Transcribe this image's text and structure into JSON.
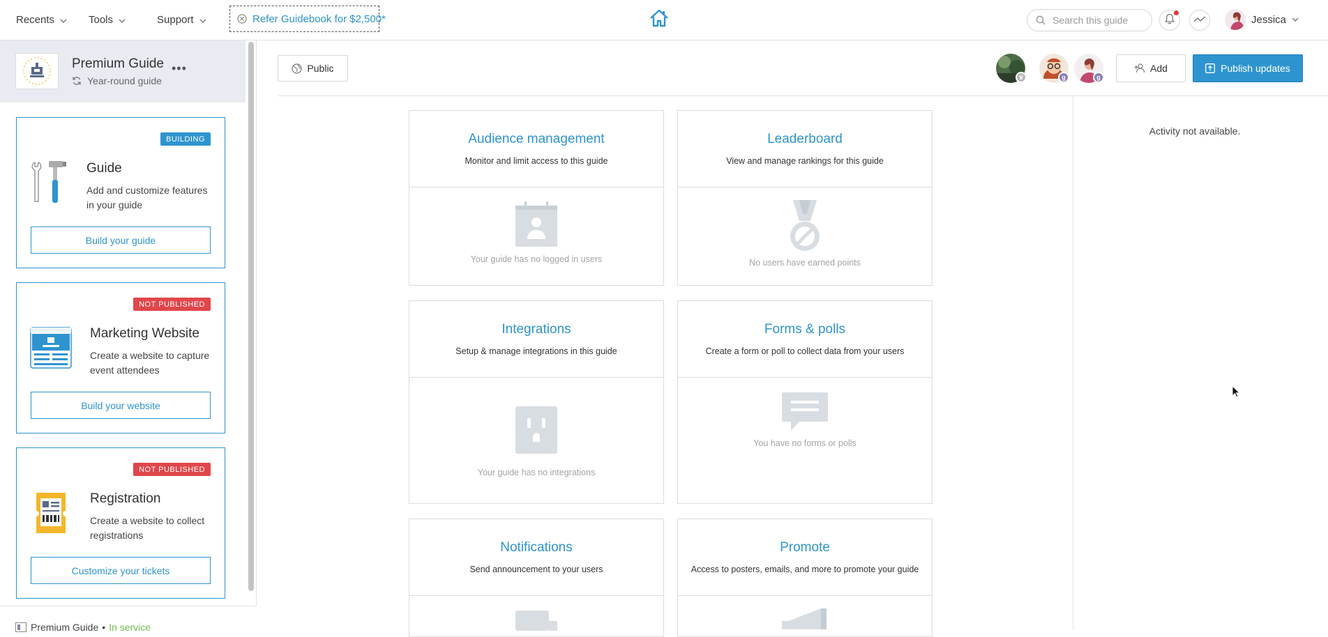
{
  "topbar": {
    "nav": [
      {
        "label": "Recents"
      },
      {
        "label": "Tools"
      },
      {
        "label": "Support"
      }
    ],
    "refer_label": "Refer Guidebook for $2,500*",
    "search_placeholder": "Search this guide",
    "user_name": "Jessica",
    "icons": {
      "home": "home-icon",
      "notifications": "bell-icon",
      "activity": "activity-graph-icon"
    },
    "colors": {
      "accent": "#2e94cf",
      "notification_dot": "#e0383e"
    }
  },
  "sidebar": {
    "guide_name": "Premium Guide",
    "guide_type": "Year-round guide",
    "cards": [
      {
        "badge": "BUILDING",
        "badge_color": "#2e94cf",
        "title": "Guide",
        "description": "Add and customize features in your guide",
        "button": "Build your guide",
        "icon": "tools-icon"
      },
      {
        "badge": "NOT PUBLISHED",
        "badge_color": "#e0464a",
        "title": "Marketing Website",
        "description": "Create a website to capture event attendees",
        "button": "Build your website",
        "icon": "website-icon"
      },
      {
        "badge": "NOT PUBLISHED",
        "badge_color": "#e0464a",
        "title": "Registration",
        "description": "Create a website to collect registrations",
        "button": "Customize your tickets",
        "icon": "ticket-icon"
      }
    ],
    "footer": {
      "guide_name": "Premium Guide",
      "separator": "•",
      "status": "In service",
      "status_color": "#6cc04a"
    }
  },
  "main": {
    "visibility_label": "Public",
    "add_label": "Add",
    "publish_label": "Publish updates",
    "activity_text": "Activity not available.",
    "features": [
      {
        "title": "Audience management",
        "description": "Monitor and limit access to this guide",
        "empty": "Your guide has no logged in users",
        "icon": "badge-id-icon"
      },
      {
        "title": "Leaderboard",
        "description": "View and manage rankings for this guide",
        "empty": "No users have earned points",
        "icon": "medal-icon"
      },
      {
        "title": "Integrations",
        "description": "Setup & manage integrations in this guide",
        "empty": "Your guide has no integrations",
        "icon": "outlet-icon"
      },
      {
        "title": "Forms & polls",
        "description": "Create a form or poll to collect data from your users",
        "empty": "You have no forms or polls",
        "icon": "chat-bubble-icon"
      },
      {
        "title": "Notifications",
        "description": "Send announcement to your users",
        "empty": "",
        "icon": "notification-icon"
      },
      {
        "title": "Promote",
        "description": "Access to posters, emails, and more to promote your guide",
        "empty": "",
        "icon": "megaphone-icon"
      }
    ]
  }
}
